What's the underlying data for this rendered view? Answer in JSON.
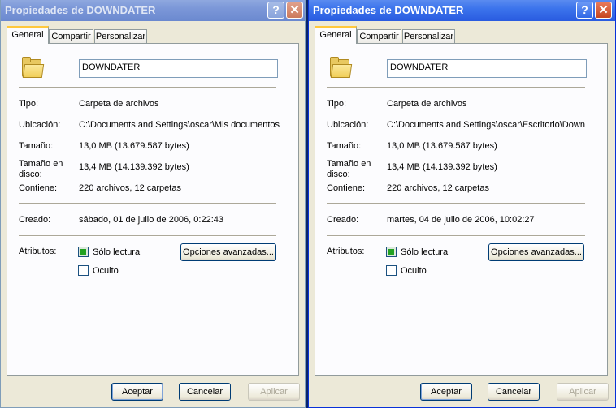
{
  "dialogs": [
    {
      "title": "Propiedades de DOWNDATER",
      "help_glyph": "?",
      "close_glyph": "✕",
      "tabs": [
        "General",
        "Compartir",
        "Personalizar"
      ],
      "name": "DOWNDATER",
      "fields": {
        "tipo_label": "Tipo:",
        "tipo": "Carpeta de archivos",
        "ubicacion_label": "Ubicación:",
        "ubicacion": "C:\\Documents and Settings\\oscar\\Mis documentos",
        "tamano_label": "Tamaño:",
        "tamano": "13,0 MB (13.679.587 bytes)",
        "tamano_disco_label": "Tamaño en disco:",
        "tamano_disco": "13,4 MB (14.139.392 bytes)",
        "contiene_label": "Contiene:",
        "contiene": "220 archivos, 12 carpetas",
        "creado_label": "Creado:",
        "creado": "sábado, 01 de julio de 2006, 0:22:43",
        "atributos_label": "Atributos:"
      },
      "solo_lectura": "Sólo lectura",
      "oculto": "Oculto",
      "opciones": "Opciones avanzadas...",
      "buttons": {
        "aceptar": "Aceptar",
        "cancelar": "Cancelar",
        "aplicar": "Aplicar"
      }
    },
    {
      "title": "Propiedades de DOWNDATER",
      "help_glyph": "?",
      "close_glyph": "✕",
      "tabs": [
        "General",
        "Compartir",
        "Personalizar"
      ],
      "name": "DOWNDATER",
      "fields": {
        "tipo_label": "Tipo:",
        "tipo": "Carpeta de archivos",
        "ubicacion_label": "Ubicación:",
        "ubicacion": "C:\\Documents and Settings\\oscar\\Escritorio\\Down",
        "tamano_label": "Tamaño:",
        "tamano": "13,0 MB (13.679.587 bytes)",
        "tamano_disco_label": "Tamaño en disco:",
        "tamano_disco": "13,4 MB (14.139.392 bytes)",
        "contiene_label": "Contiene:",
        "contiene": "220 archivos, 12 carpetas",
        "creado_label": "Creado:",
        "creado": "martes, 04 de julio de 2006, 10:02:27",
        "atributos_label": "Atributos:"
      },
      "solo_lectura": "Sólo lectura",
      "oculto": "Oculto",
      "opciones": "Opciones avanzadas...",
      "buttons": {
        "aceptar": "Aceptar",
        "cancelar": "Cancelar",
        "aplicar": "Aplicar"
      }
    }
  ]
}
